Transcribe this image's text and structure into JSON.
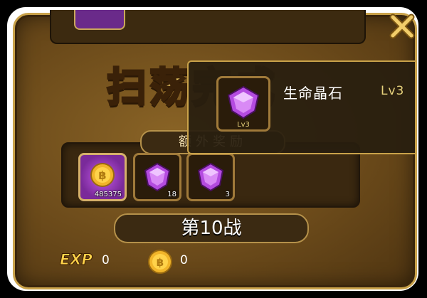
{
  "window": {
    "title": "扫荡完成"
  },
  "rewards_header": "额外奖励",
  "rewards": [
    {
      "item": "gold-coin",
      "count": "485375"
    },
    {
      "item": "purple-gem",
      "count": "18"
    },
    {
      "item": "purple-gem",
      "count": "3"
    }
  ],
  "battle_label": "第10战",
  "footer": {
    "exp_label": "EXP",
    "exp_value": "0",
    "coin_value": "0"
  },
  "tooltip": {
    "item_name": "生命晶石",
    "level": "Lv3",
    "slot_level": "Lv3"
  },
  "colors": {
    "gold": "#f7d46a",
    "panel": "#6b4a1a",
    "gem": "#b44be0"
  }
}
